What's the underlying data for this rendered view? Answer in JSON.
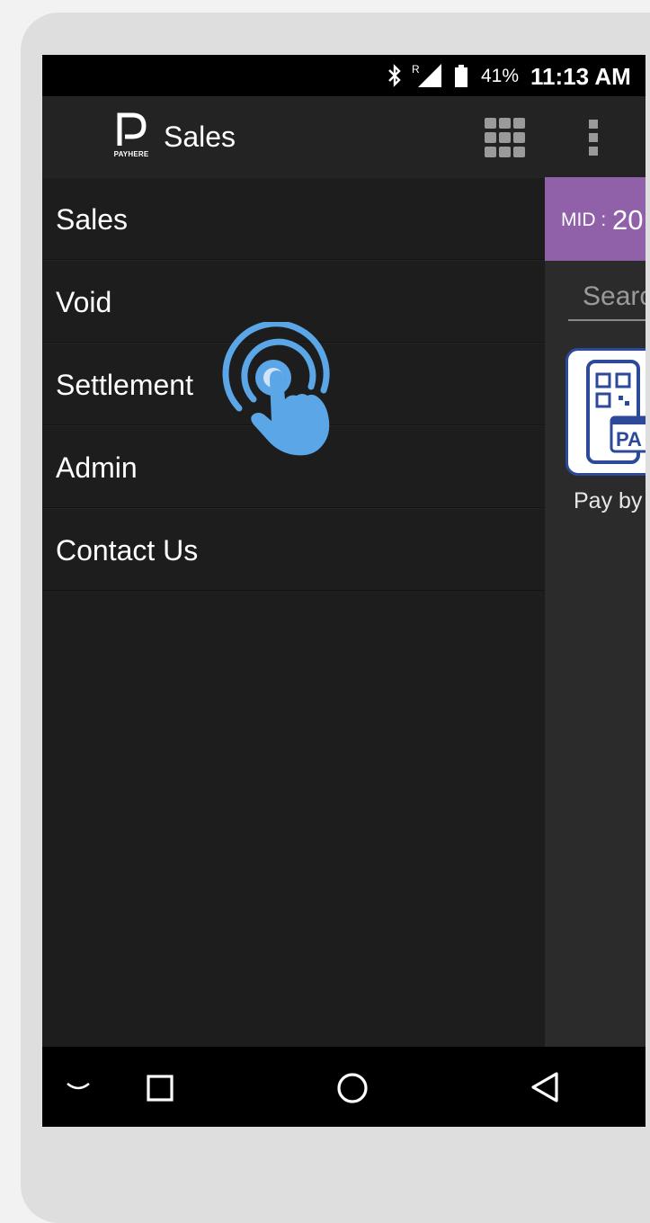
{
  "status_bar": {
    "battery_percent": "41%",
    "time": "11:13 AM",
    "icons": [
      "bluetooth-icon",
      "roaming-signal-icon",
      "battery-icon"
    ]
  },
  "app_bar": {
    "logo_text": "PAYHERE",
    "title": "Sales",
    "icons": [
      "apps-grid-icon",
      "more-vert-icon"
    ]
  },
  "drawer": {
    "items": [
      {
        "label": "Sales"
      },
      {
        "label": "Void"
      },
      {
        "label": "Settlement"
      },
      {
        "label": "Admin"
      },
      {
        "label": "Contact Us"
      }
    ]
  },
  "main": {
    "mid_label": "MID :",
    "mid_value": "20",
    "search_placeholder": "Searc",
    "tile_text": "PA",
    "tile_label": "Pay by"
  },
  "nav_bar": {
    "icons": [
      "hide-keyboard-icon",
      "recents-icon",
      "home-icon",
      "back-icon"
    ]
  },
  "colors": {
    "accent_purple": "#9061a8",
    "tile_blue": "#2d4a9a",
    "tap_blue": "#5aa6e6"
  }
}
